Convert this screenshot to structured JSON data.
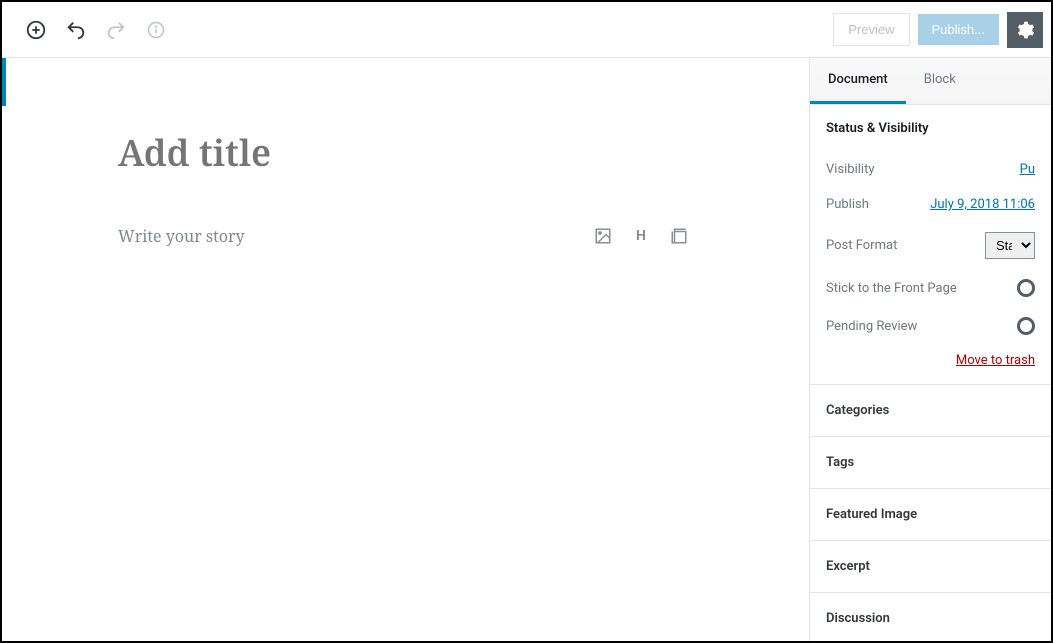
{
  "toolbar": {
    "preview_label": "Preview",
    "publish_label": "Publish..."
  },
  "editor": {
    "title_placeholder": "Add title",
    "body_placeholder": "Write your story"
  },
  "sidebar": {
    "tabs": {
      "document": "Document",
      "block": "Block"
    },
    "status": {
      "heading": "Status & Visibility",
      "visibility_label": "Visibility",
      "visibility_value": "Pu",
      "publish_label": "Publish",
      "publish_value": "July 9, 2018 11:06",
      "format_label": "Post Format",
      "format_value": "Standard",
      "stick_label": "Stick to the Front Page",
      "pending_label": "Pending Review",
      "trash_label": "Move to trash"
    },
    "panels": {
      "categories": "Categories",
      "tags": "Tags",
      "featured_image": "Featured Image",
      "excerpt": "Excerpt",
      "discussion": "Discussion"
    }
  }
}
